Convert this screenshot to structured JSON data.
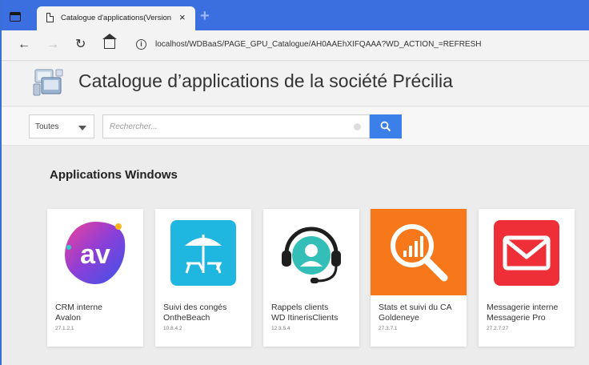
{
  "browser": {
    "tab_title": "Catalogue d'applications(Version",
    "close_glyph": "×",
    "new_tab_glyph": "+",
    "url": "localhost/WDBaaS/PAGE_GPU_Catalogue/AH0AAEhXIFQAAA?WD_ACTION_=REFRESH",
    "back_glyph": "←",
    "forward_glyph": "→",
    "reload_glyph": "↻",
    "info_glyph": "i"
  },
  "header": {
    "title": "Catalogue d’applications de la société Précilia"
  },
  "search": {
    "filter_value": "Toutes",
    "placeholder": "Rechercher..."
  },
  "section": {
    "title": "Applications Windows"
  },
  "apps": [
    {
      "name_line1": "CRM interne",
      "name_line2": "Avalon",
      "version": "27.1.2.1",
      "icon": "avalon-av-icon"
    },
    {
      "name_line1": "Suivi des congés",
      "name_line2": "OntheBeach",
      "version": "10.8.4.2",
      "icon": "beach-umbrella-icon"
    },
    {
      "name_line1": "Rappels clients",
      "name_line2": "WD ItinerisClients",
      "version": "12.3.5.4",
      "icon": "headset-user-icon"
    },
    {
      "name_line1": "Stats et suivi du CA",
      "name_line2": "Goldeneye",
      "version": "27.3.7.1",
      "icon": "magnifier-chart-icon"
    },
    {
      "name_line1": "Messagerie interne",
      "name_line2": "Messagerie Pro",
      "version": "27.2.7.27",
      "icon": "envelope-icon"
    }
  ],
  "colors": {
    "tabstrip": "#3b6fe0",
    "search_button": "#3b80e8",
    "beach_icon_bg": "#1fb6e0",
    "stats_icon_bg": "#f7781a",
    "mail_icon_bg": "#ee2f37"
  }
}
